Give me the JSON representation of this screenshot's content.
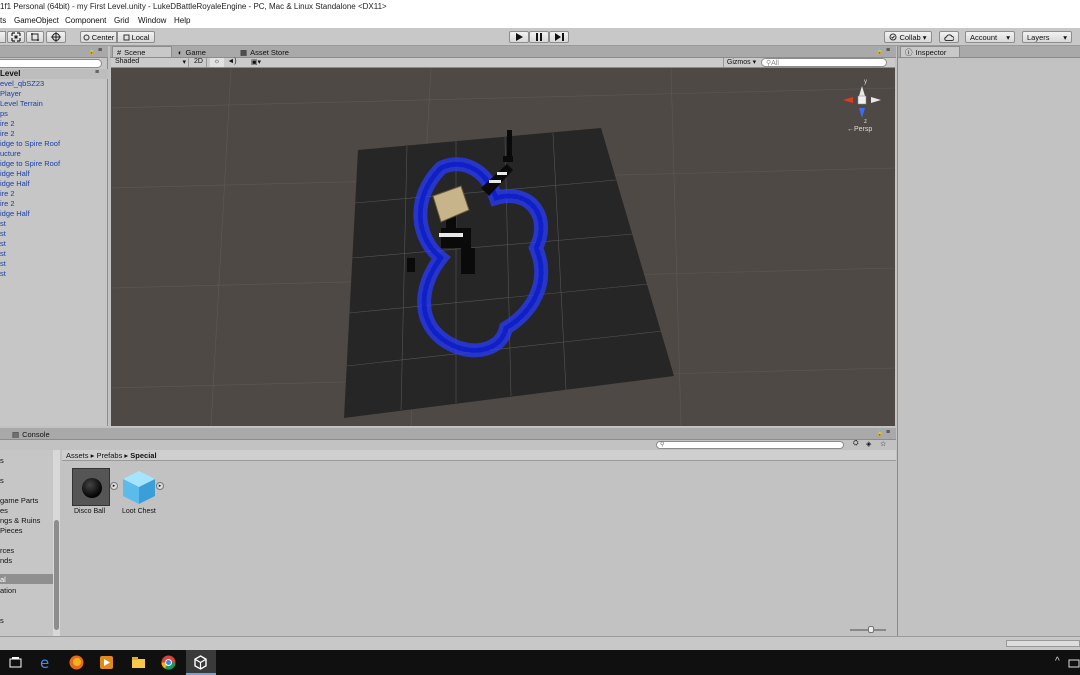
{
  "window": {
    "title": "1f1 Personal (64bit) - my First Level.unity - LukeDBattleRoyaleEngine - PC, Mac & Linux Standalone <DX11>"
  },
  "menu": [
    "ts",
    "GameObject",
    "Component",
    "Grid",
    "Window",
    "Help"
  ],
  "toolbar": {
    "pivot_label": "Center",
    "space_label": "Local",
    "collab_label": "Collab ▾",
    "account_label": "Account",
    "layers_label": "Layers"
  },
  "scene_tabs": {
    "scene": "Scene",
    "game": "Game",
    "asset_store": "Asset Store"
  },
  "scene_bar": {
    "shading": "Shaded",
    "mode_2d": "2D",
    "gizmos": "Gizmos ▾",
    "search_placeholder": "All"
  },
  "gizmo": {
    "axis_y": "y",
    "axis_z": "z",
    "persp": "←Persp"
  },
  "inspector": {
    "tab": "Inspector"
  },
  "hierarchy": {
    "title": "Level",
    "items": [
      "evel_qbSZ23",
      "Player",
      " Level Terrain",
      "ps",
      "ire 2",
      "ire 2",
      "idge to Spire Roof",
      "ucture",
      "idge to Spire Roof",
      "idge Half",
      "idge Half",
      "ire 2",
      "ire 2",
      "idge Half",
      "st",
      "st",
      "st",
      "st",
      "st",
      "st"
    ]
  },
  "bottom_tabs": {
    "console": "Console"
  },
  "project": {
    "breadcrumb": [
      "Assets",
      "Prefabs",
      "Special"
    ],
    "folders": [
      "s",
      "",
      "s",
      "",
      "game Parts",
      "es",
      "ngs & Ruins",
      "Pieces",
      "",
      "rces",
      "nds",
      "",
      "al",
      "ation",
      "",
      "",
      "s"
    ],
    "assets": [
      {
        "name": "Disco Ball"
      },
      {
        "name": "Loot Chest"
      }
    ]
  },
  "colors": {
    "hierarchy_text": "#1a3fa8",
    "scene_bg": "#4e4944",
    "ground_plane": "#262626",
    "blue_structure": "#2a3cff"
  }
}
